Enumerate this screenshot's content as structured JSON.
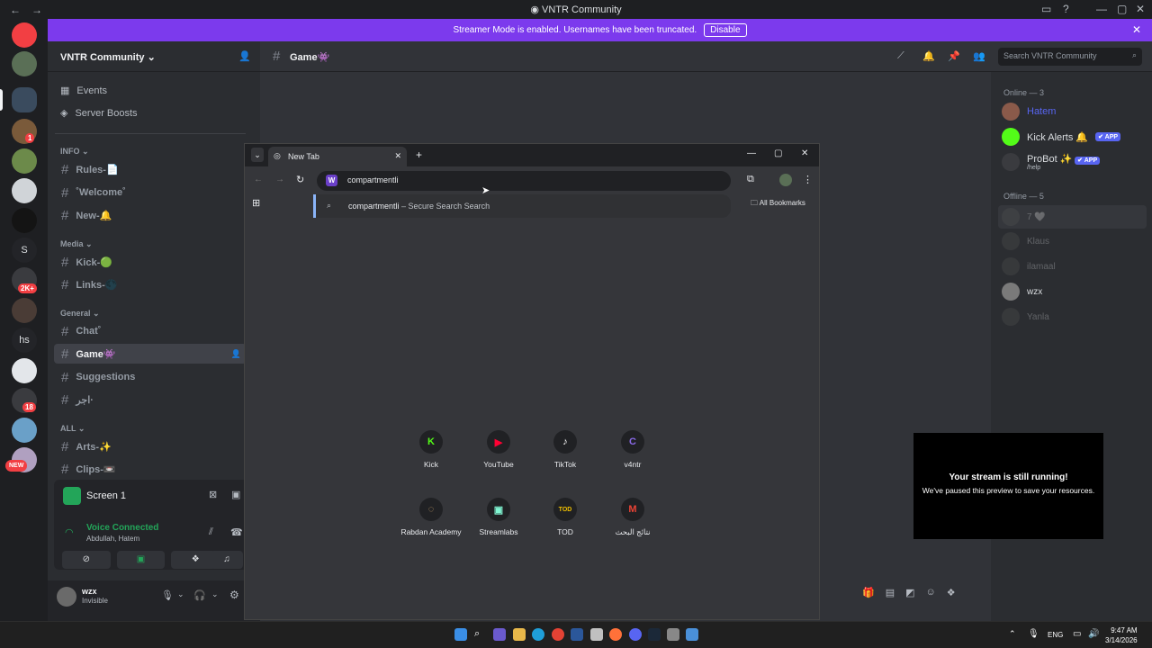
{
  "window": {
    "title": "VNTR Community"
  },
  "banner": {
    "text": "Streamer Mode is enabled. Usernames have been truncated.",
    "button": "Disable"
  },
  "server": {
    "name": "VNTR Community"
  },
  "sidebar": {
    "links": [
      {
        "label": "Events"
      },
      {
        "label": "Server Boosts"
      }
    ],
    "categories": [
      {
        "label": "INFO",
        "channels": [
          {
            "label": "Rules-📄"
          },
          {
            "label": "˚Welcome˚"
          },
          {
            "label": "New-🔔"
          }
        ]
      },
      {
        "label": "Media",
        "channels": [
          {
            "label": "Kick-🟢"
          },
          {
            "label": "Links-🌑"
          }
        ]
      },
      {
        "label": "General",
        "channels": [
          {
            "label": "Chat˚"
          },
          {
            "label": "Game👾"
          },
          {
            "label": "Suggestions"
          },
          {
            "label": "اجر·"
          }
        ]
      },
      {
        "label": "ALL",
        "channels": [
          {
            "label": "Arts-✨"
          },
          {
            "label": "Clips-📼"
          }
        ]
      }
    ]
  },
  "voice": {
    "screen_label": "Screen 1",
    "status": "Voice Connected",
    "participants": "Abdullah, Hatem"
  },
  "user": {
    "name": "wzx",
    "status": "Invisible"
  },
  "guild_badges": {
    "b1": "1",
    "b2": "2K+",
    "b3": "18",
    "new": "NEW",
    "s_letter": "S",
    "hs": "hs"
  },
  "chat": {
    "channel_name": "Game👾"
  },
  "search": {
    "placeholder": "Search VNTR Community"
  },
  "members": {
    "online_header": "Online — 3",
    "online": [
      {
        "name": "Hatem",
        "sub": ""
      },
      {
        "name": "Kick Alerts 🔔",
        "tag": "✔ APP"
      },
      {
        "name": "ProBot ✨",
        "tag": "✔ APP",
        "sub": "/help"
      }
    ],
    "offline_header": "Offline — 5",
    "offline": [
      {
        "name": "7 🤍"
      },
      {
        "name": "Klaus"
      },
      {
        "name": "ilamaal"
      },
      {
        "name": "wzx"
      },
      {
        "name": "Yanla"
      }
    ]
  },
  "browser": {
    "tab_title": "New Tab",
    "omnibox_value": "compartmentli",
    "suggestion": {
      "query": "compartmentli",
      "suffix": " – Secure Search Search"
    },
    "bookmarks_label": "All Bookmarks",
    "shortcuts_row1": [
      {
        "label": "Kick"
      },
      {
        "label": "YouTube"
      },
      {
        "label": "TikTok"
      },
      {
        "label": "v4ntr"
      }
    ],
    "shortcuts_row2": [
      {
        "label": "Rabdan Academy"
      },
      {
        "label": "Streamlabs"
      },
      {
        "label": "TOD"
      },
      {
        "label": "نتائج البحث"
      }
    ]
  },
  "stream": {
    "title": "Your stream is still running!",
    "subtitle": "We've paused this preview to save your resources."
  },
  "taskbar": {
    "lang": "ENG",
    "time": "9:47 AM",
    "date": "3/14/2026"
  }
}
